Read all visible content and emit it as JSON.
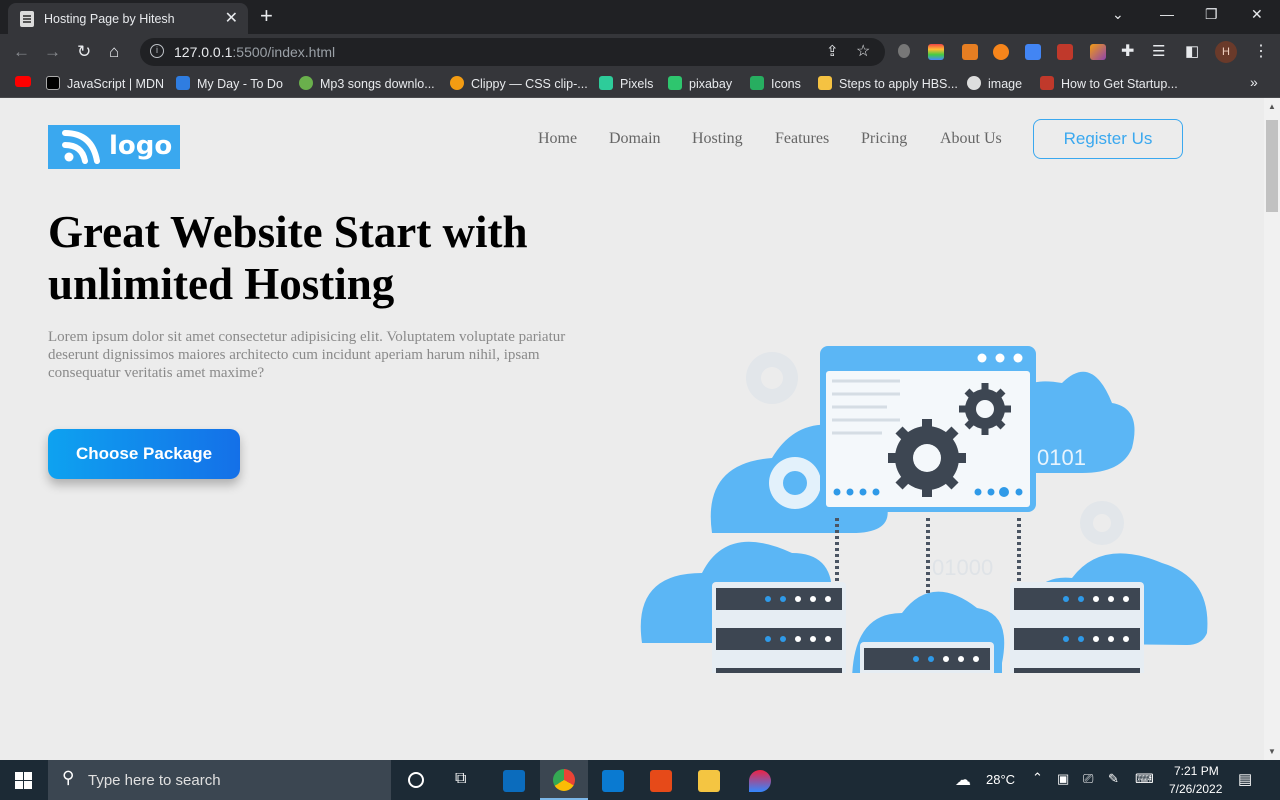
{
  "browser": {
    "tab_title": "Hosting Page by Hitesh",
    "url_host": "127.0.0.1",
    "url_rest": ":5500/index.html",
    "bookmarks": [
      {
        "label": "",
        "color": "#ff0000"
      },
      {
        "label": "JavaScript | MDN",
        "color": "#000000"
      },
      {
        "label": "My Day - To Do",
        "color": "#2f7de1"
      },
      {
        "label": "Mp3 songs downlo...",
        "color": "#6ab04c"
      },
      {
        "label": "Clippy — CSS clip-...",
        "color": "#f39c12"
      },
      {
        "label": "Pixels",
        "color": "#2ecc9a"
      },
      {
        "label": "pixabay",
        "color": "#2ec66e"
      },
      {
        "label": "Icons",
        "color": "#27ae60"
      },
      {
        "label": "Steps to apply HBS...",
        "color": "#f5c242"
      },
      {
        "label": "image",
        "color": "#dddddd"
      },
      {
        "label": "How to Get Startup...",
        "color": "#c0392b"
      }
    ],
    "profile_initial": "H"
  },
  "site": {
    "logo_text": "logo",
    "nav": [
      "Home",
      "Domain",
      "Hosting",
      "Features",
      "Pricing",
      "About Us"
    ],
    "register_label": "Register Us",
    "hero_title": "Great Website Start with unlimited Hosting",
    "hero_text": "Lorem ipsum dolor sit amet consectetur adipisicing elit. Voluptatem voluptate pariatur deserunt dignissimos maiores architecto cum incidunt aperiam harum nihil, ipsam consequatur veritatis amet maxime?",
    "cta_label": "Choose Package",
    "illustration_text": [
      "0101",
      "01000"
    ]
  },
  "taskbar": {
    "search_placeholder": "Type here to search",
    "weather": "28°C",
    "time": "7:21 PM",
    "date": "7/26/2022"
  },
  "colors": {
    "accent": "#3aa8ef",
    "cta_start": "#0ea2f0",
    "cta_end": "#1470e8",
    "cloud": "#5bb6f5"
  }
}
